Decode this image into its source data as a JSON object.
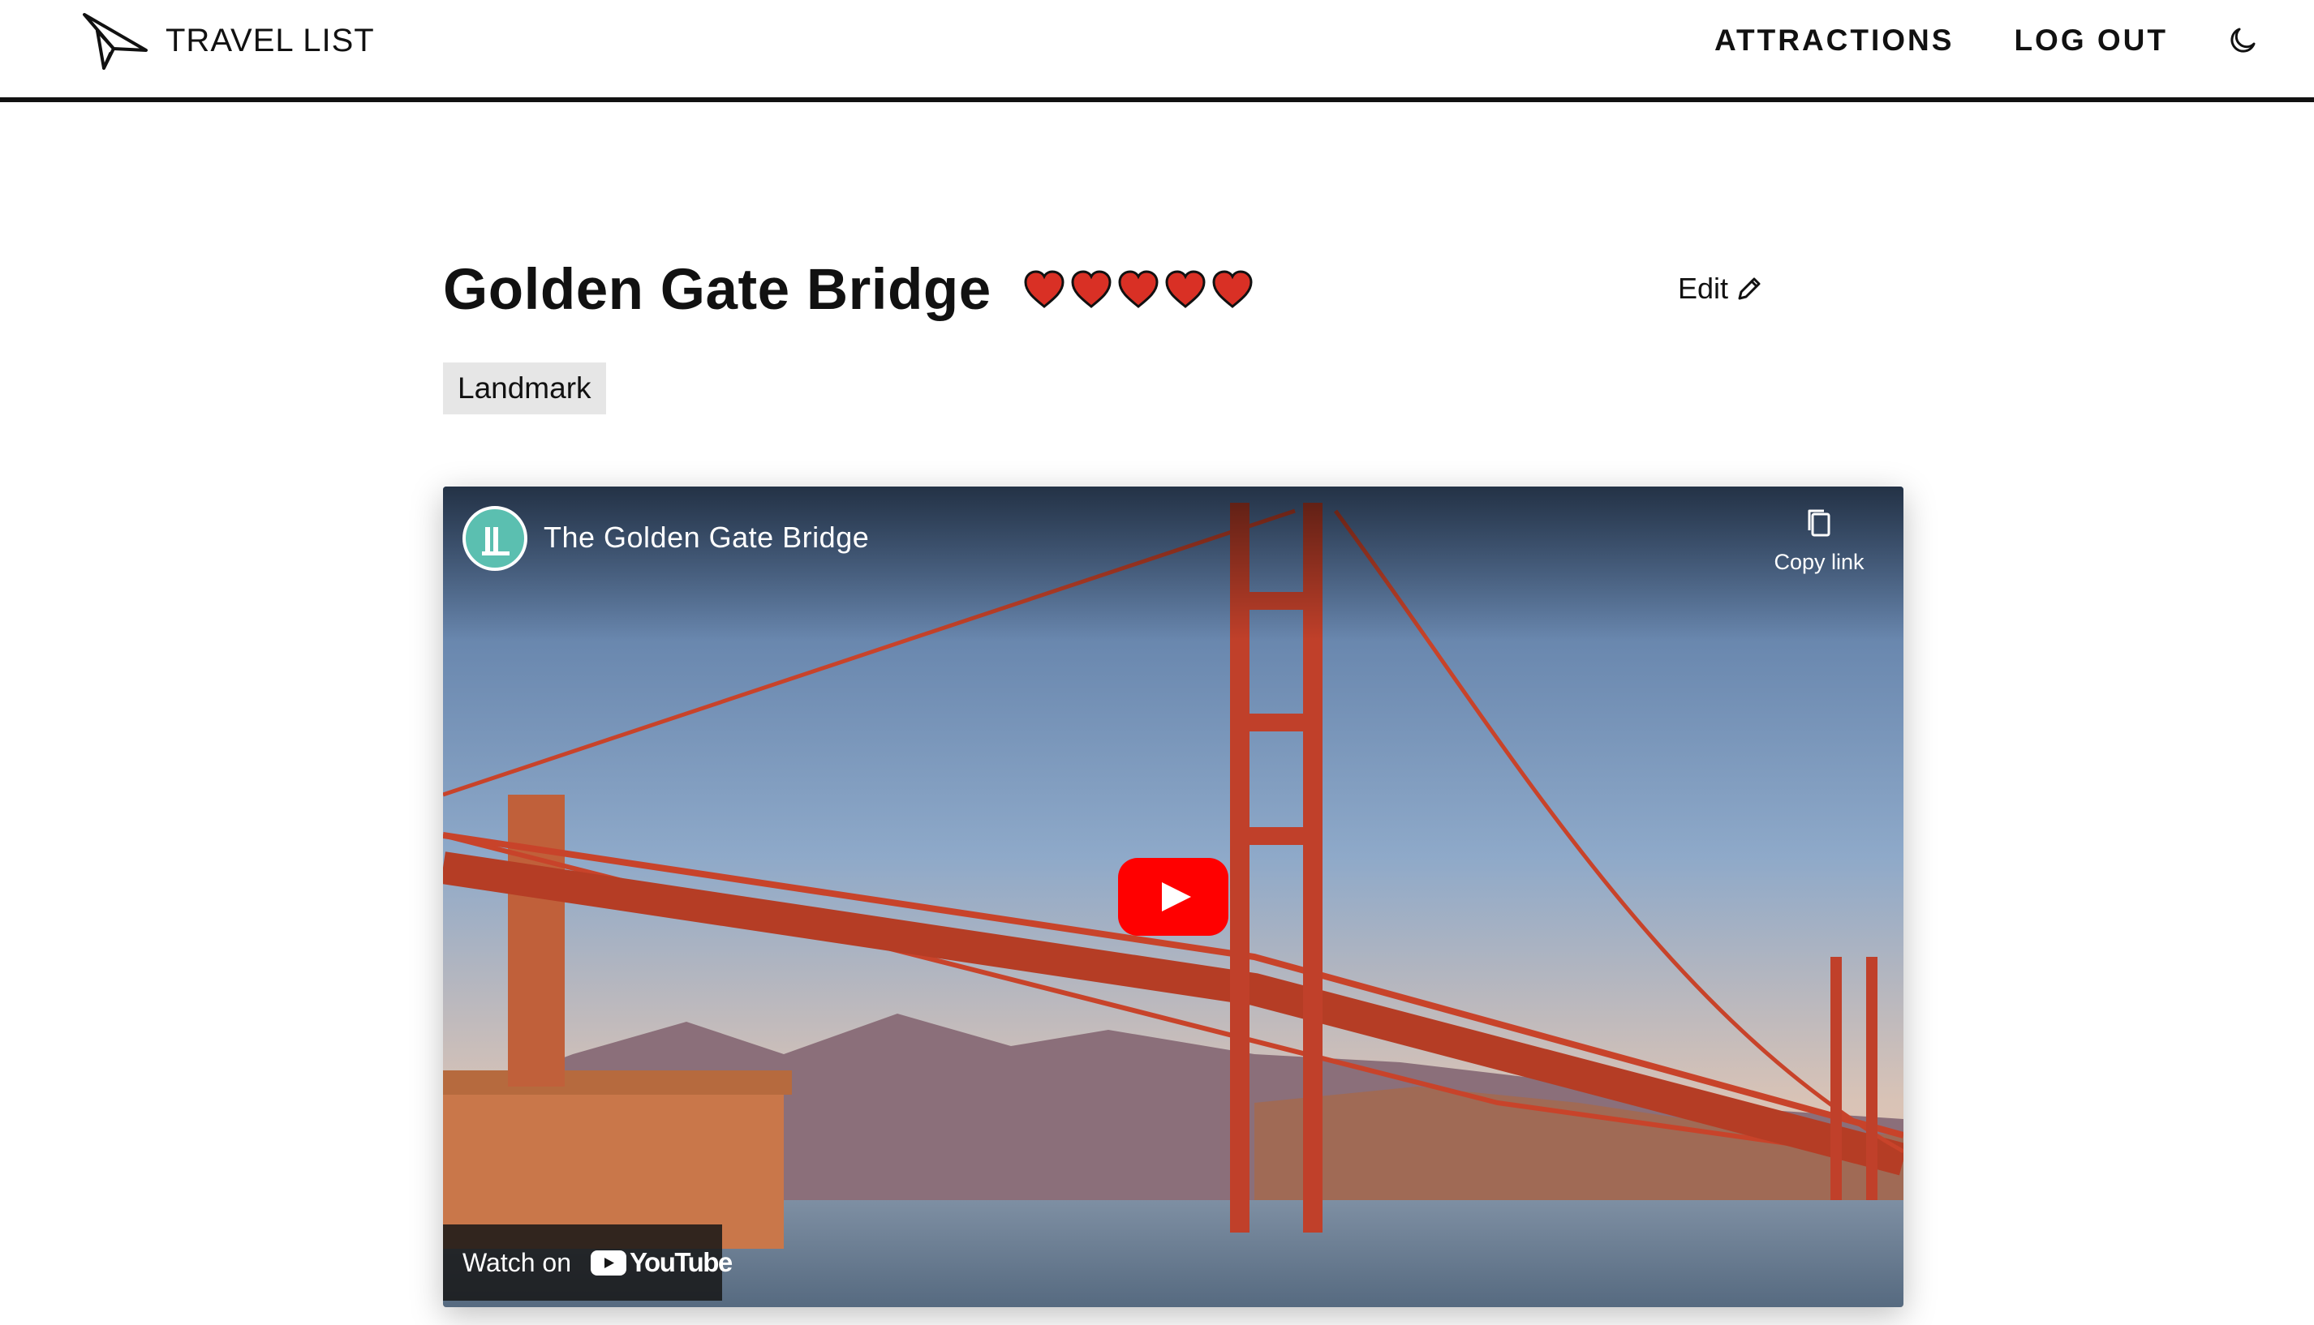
{
  "header": {
    "brand": "TRAVEL LIST",
    "nav": {
      "attractions": "ATTRACTIONS",
      "logout": "LOG OUT"
    },
    "icons": {
      "brand": "paper-plane-icon",
      "theme_toggle": "moon-icon"
    }
  },
  "attraction": {
    "title": "Golden Gate Bridge",
    "rating": 5,
    "rating_max": 5,
    "rating_icon": "heart-icon",
    "rating_color": "#d93025",
    "edit_label": "Edit",
    "edit_icon": "pencil-icon",
    "category": "Landmark"
  },
  "video": {
    "title": "The Golden Gate Bridge",
    "copy_link_label": "Copy link",
    "watch_on_label": "Watch on",
    "platform": "YouTube",
    "play_button_color": "#ff0000",
    "thumbnail_icon": "golden-gate-bridge-photo"
  },
  "colors": {
    "text": "#111111",
    "background": "#ffffff",
    "tag_background": "#e6e6e6"
  }
}
